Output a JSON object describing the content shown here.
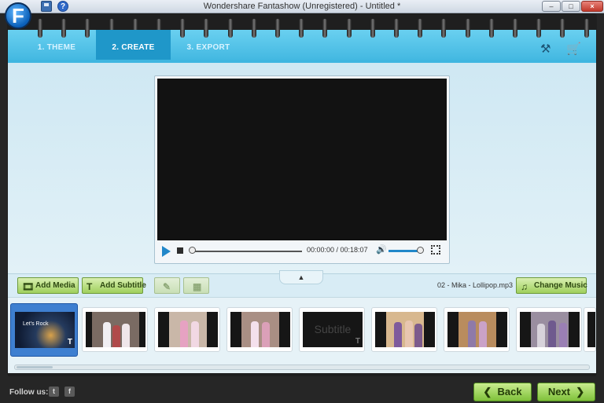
{
  "window": {
    "title": "Wondershare Fantashow (Unregistered) - Untitled *",
    "min_glyph": "–",
    "max_glyph": "□",
    "close_glyph": "×",
    "help_glyph": "?"
  },
  "logo": {
    "letter": "F"
  },
  "steps": [
    {
      "label": "1.  THEME",
      "active": false
    },
    {
      "label": "2.  CREATE",
      "active": true
    },
    {
      "label": "3.  EXPORT",
      "active": false
    }
  ],
  "header_icons": [
    "hammer-icon",
    "shopping-cart-icon"
  ],
  "player": {
    "timecode": "00:00:00 / 00:18:07",
    "progress": 0.0,
    "volume": 0.85
  },
  "toolbar": {
    "add_media_label": "Add Media",
    "add_subtitle_label": "Add Subtitle",
    "music_track": "02  - Mika - Lollipop.mp3",
    "change_music_label": "Change Music",
    "collapse_glyph": "▲"
  },
  "timeline": {
    "clips": [
      {
        "type": "title",
        "text": "Let's Rock",
        "selected": true
      },
      {
        "type": "photo"
      },
      {
        "type": "photo"
      },
      {
        "type": "photo"
      },
      {
        "type": "subtitle",
        "text": "Subtitle"
      },
      {
        "type": "photo"
      },
      {
        "type": "photo"
      },
      {
        "type": "photo"
      },
      {
        "type": "photo"
      }
    ]
  },
  "footer": {
    "follow_label": "Follow us:",
    "back_label": "Back",
    "next_label": "Next"
  },
  "colors": {
    "accent_blue": "#3fb6e0",
    "active_step": "#1f97c9",
    "button_green": "#9fd05d"
  }
}
